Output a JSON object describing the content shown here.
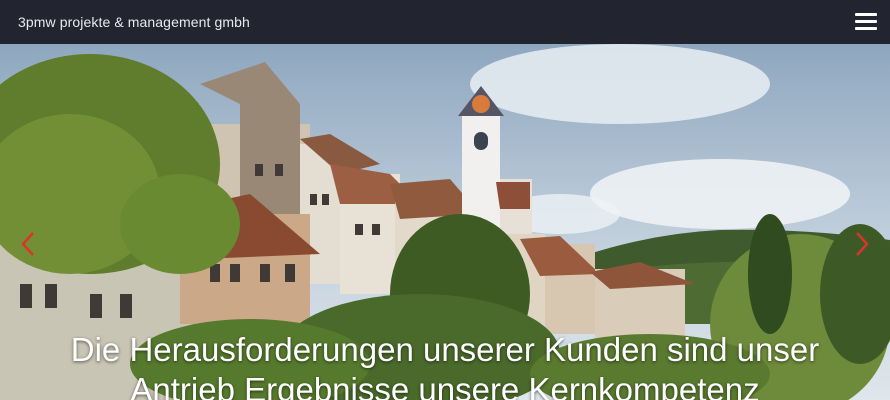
{
  "navbar": {
    "brand": "3pmw projekte & management gmbh",
    "menu_icon": "hamburger-menu-icon"
  },
  "hero": {
    "caption_line1": "Die Herausforderungen unserer Kunden sind unser",
    "caption_line2": "Antrieb Ergebnisse unsere Kernkompetenz",
    "prev_icon": "chevron-left-icon",
    "next_icon": "chevron-right-icon",
    "arrow_color": "#d9352b"
  }
}
